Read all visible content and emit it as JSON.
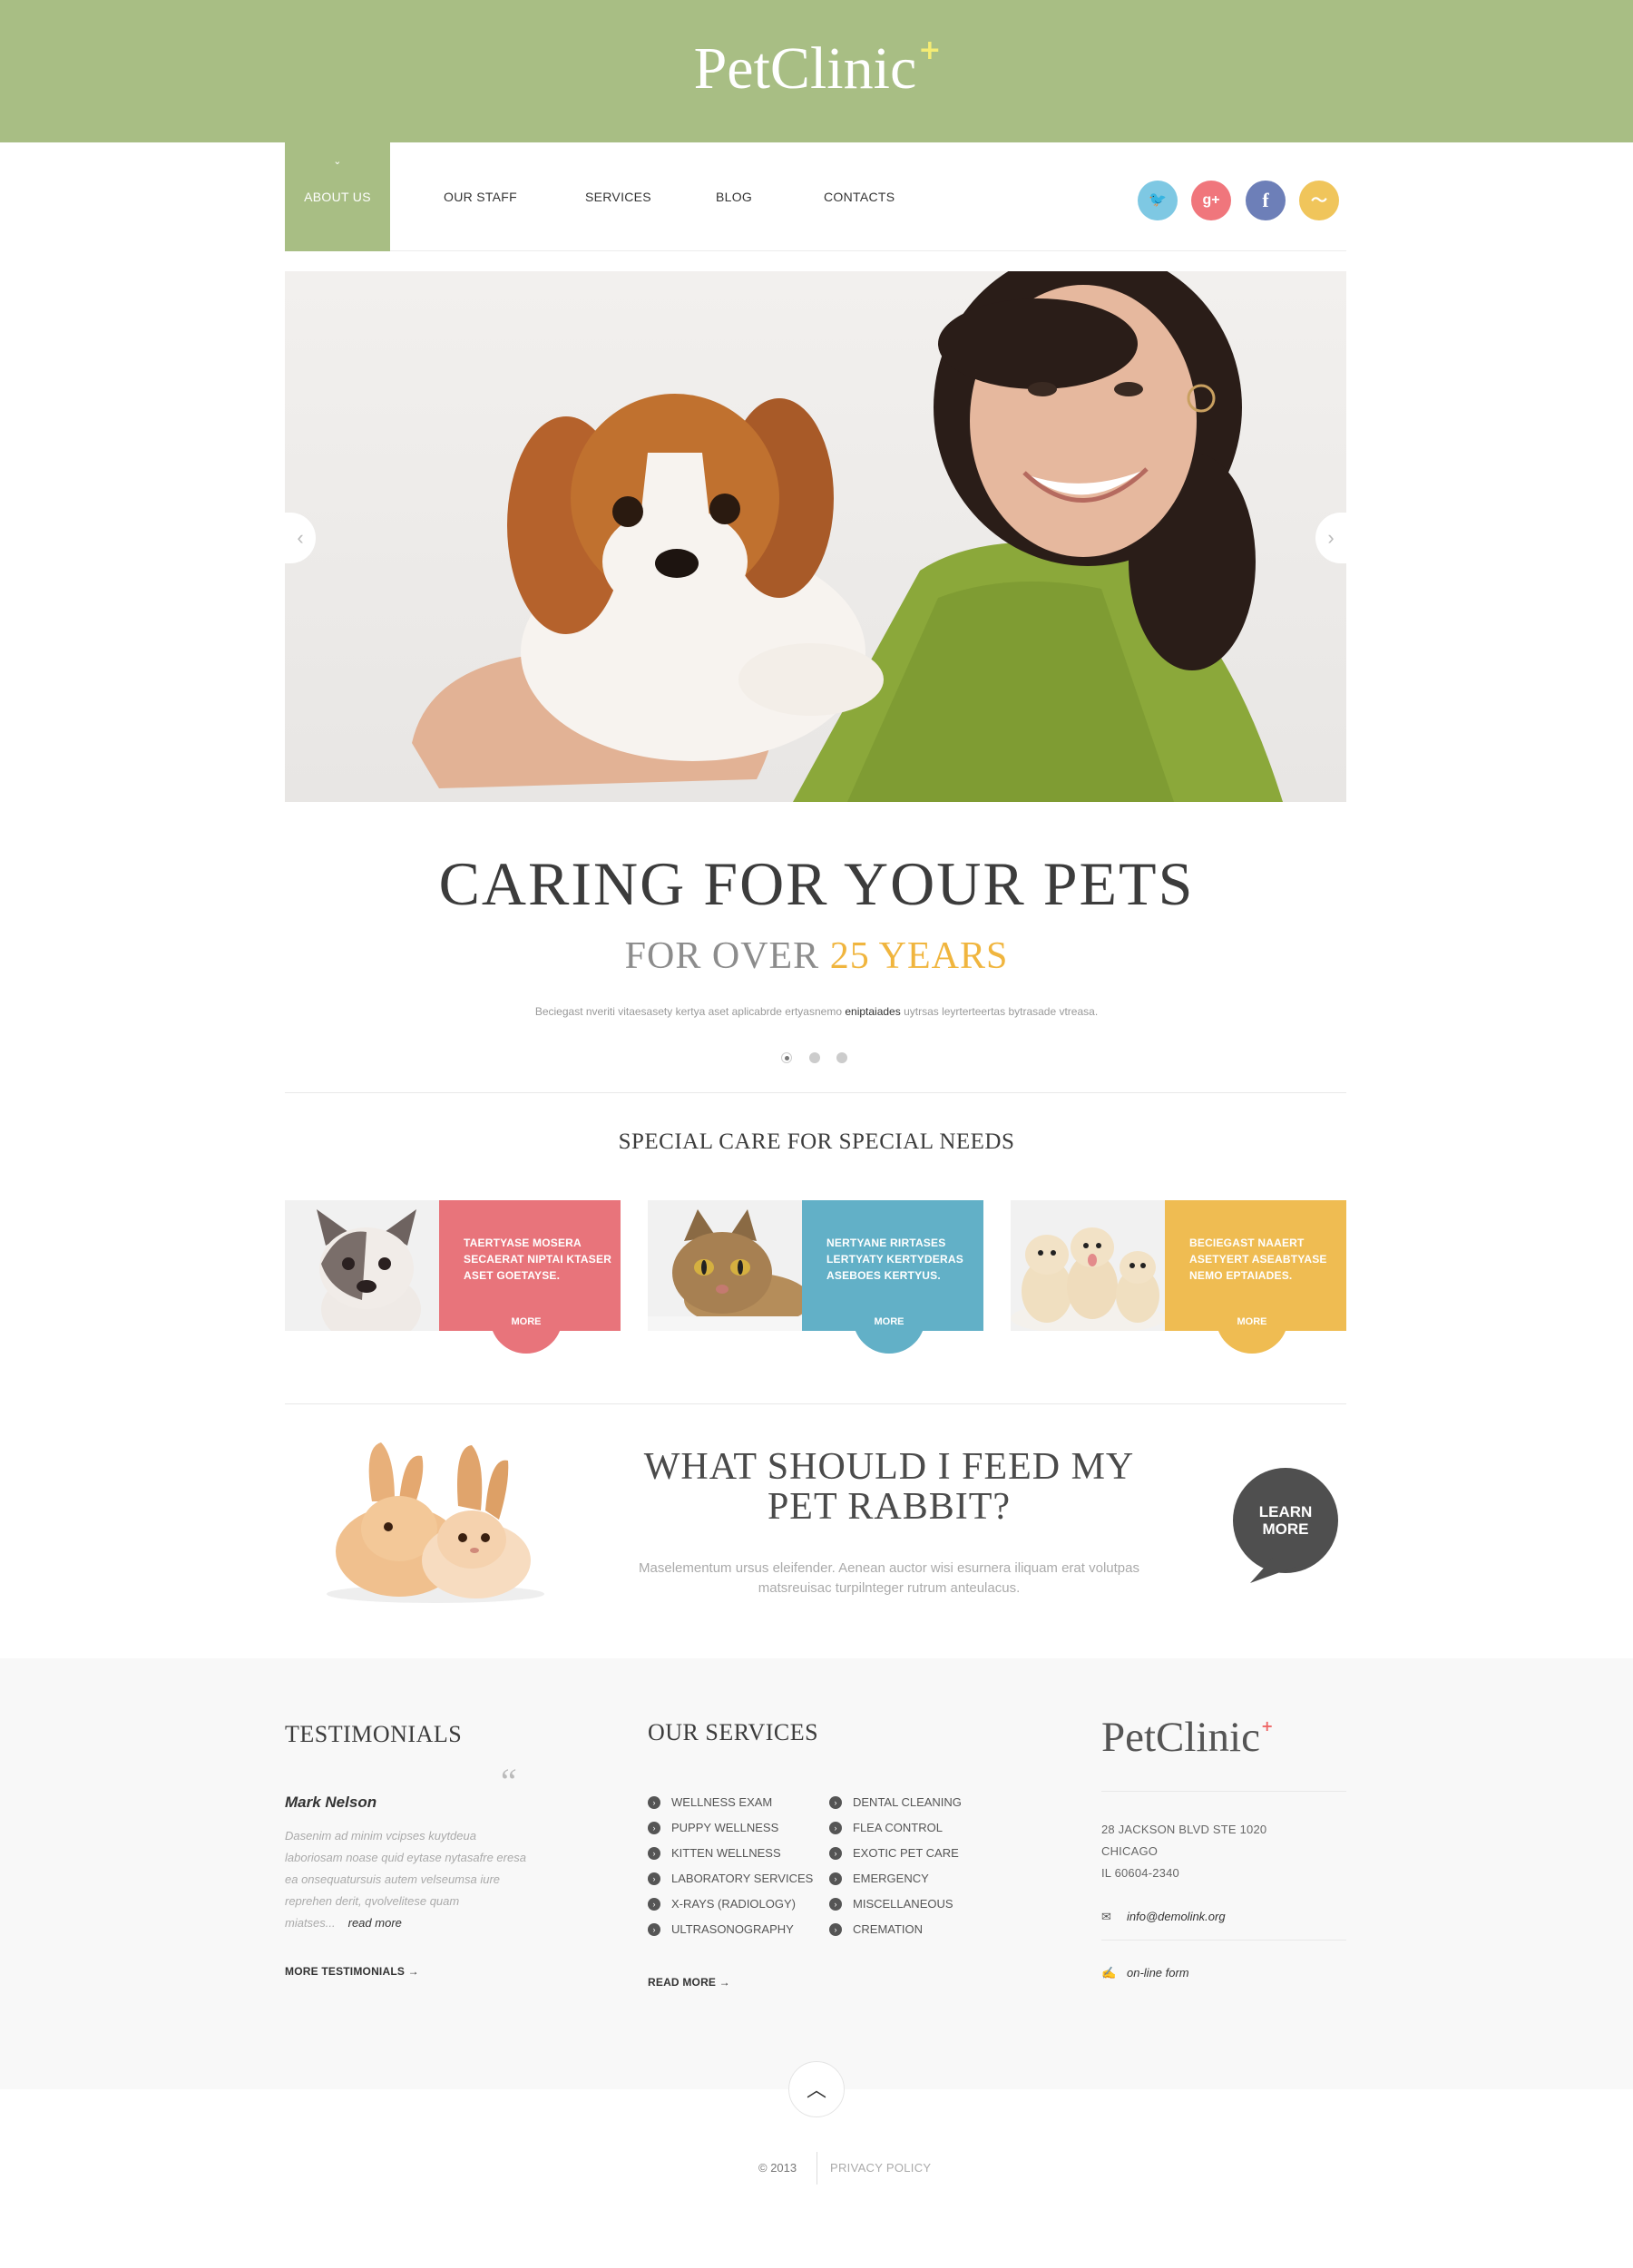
{
  "header": {
    "logo_text": "PetClinic",
    "logo_mark": "+"
  },
  "nav": {
    "active_caret": "⌄",
    "items": [
      {
        "label": "ABOUT US"
      },
      {
        "label": "OUR STAFF"
      },
      {
        "label": "SERVICES"
      },
      {
        "label": "BLOG"
      },
      {
        "label": "CONTACTS"
      }
    ]
  },
  "social": [
    {
      "name": "twitter",
      "glyph": "🐦",
      "color": "#7ec8e3"
    },
    {
      "name": "google-plus",
      "glyph": "g+",
      "color": "#f0767c"
    },
    {
      "name": "facebook",
      "glyph": "f",
      "color": "#6d7fb8"
    },
    {
      "name": "rss",
      "glyph": "〜",
      "color": "#f0c55b"
    }
  ],
  "hero": {
    "title": "CARING FOR YOUR PETS",
    "subtitle_prefix": "FOR OVER ",
    "subtitle_highlight": "25 YEARS",
    "text_before": "Beciegast nveriti vitaesasety kertya aset aplicabrde ertyasnemo ",
    "text_bold": "eniptaiades",
    "text_after": " uytrsas leyrterteertas bytrasade vtreasa."
  },
  "special": {
    "title": "SPECIAL CARE FOR SPECIAL NEEDS",
    "cards": [
      {
        "text": "TAERTYASE MOSERA SECAERAT NIPTAI KTASER ASET GOETAYSE.",
        "more": "MORE",
        "color": "#e8747b"
      },
      {
        "text": "NERTYANE RIRTASES LERTYATY KERTYDERAS ASEBOES KERTYUS.",
        "more": "MORE",
        "color": "#62b0c7"
      },
      {
        "text": "BECIEGAST NAAERT ASETYERT ASEABTYASE NEMO EPTAIADES.",
        "more": "MORE",
        "color": "#efbc52"
      }
    ]
  },
  "feed": {
    "title_line1": "WHAT SHOULD I FEED MY",
    "title_line2": "PET RABBIT?",
    "text_line1": "Maselementum ursus eleifender. Aenean auctor wisi esurnera iliquam erat volutpas",
    "text_line2": "matsreuisac turpilnteger rutrum anteulacus.",
    "learn_line1": "LEARN",
    "learn_line2": "MORE"
  },
  "testimonials": {
    "title": "TESTIMONIALS",
    "quote_mark": "“",
    "author": "Mark Nelson",
    "text": "Dasenim ad minim vcipses kuytdeua laboriosam noase quid eytase nytasafre eresa ea onsequatursuis autem velseumsa iure reprehen derit, qvolvelitese quam miatses...",
    "read_more": "read more",
    "more_link": "MORE TESTIMONIALS  →"
  },
  "services": {
    "title": "OUR SERVICES",
    "bullet": "›",
    "col1": [
      "WELLNESS EXAM",
      "PUPPY WELLNESS",
      "KITTEN WELLNESS",
      "LABORATORY SERVICES",
      "X-RAYS (RADIOLOGY)",
      "ULTRASONOGRAPHY"
    ],
    "col2": [
      "DENTAL CLEANING",
      "FLEA CONTROL",
      "EXOTIC PET CARE",
      "EMERGENCY",
      "MISCELLANEOUS",
      "CREMATION"
    ],
    "read_more": "READ MORE  →"
  },
  "contact": {
    "logo_text": "PetClinic",
    "logo_mark": "+",
    "address": [
      "28 JACKSON BLVD STE 1020",
      "CHICAGO",
      "IL 60604-2340"
    ],
    "email": "info@demolink.org",
    "form": "on-line form",
    "email_icon": "✉",
    "form_icon": "✍"
  },
  "footer": {
    "totop_glyph": "︿",
    "copyright": "© 2013",
    "privacy": "PRIVACY POLICY"
  },
  "slider": {
    "prev_glyph": "‹",
    "next_glyph": "›"
  }
}
